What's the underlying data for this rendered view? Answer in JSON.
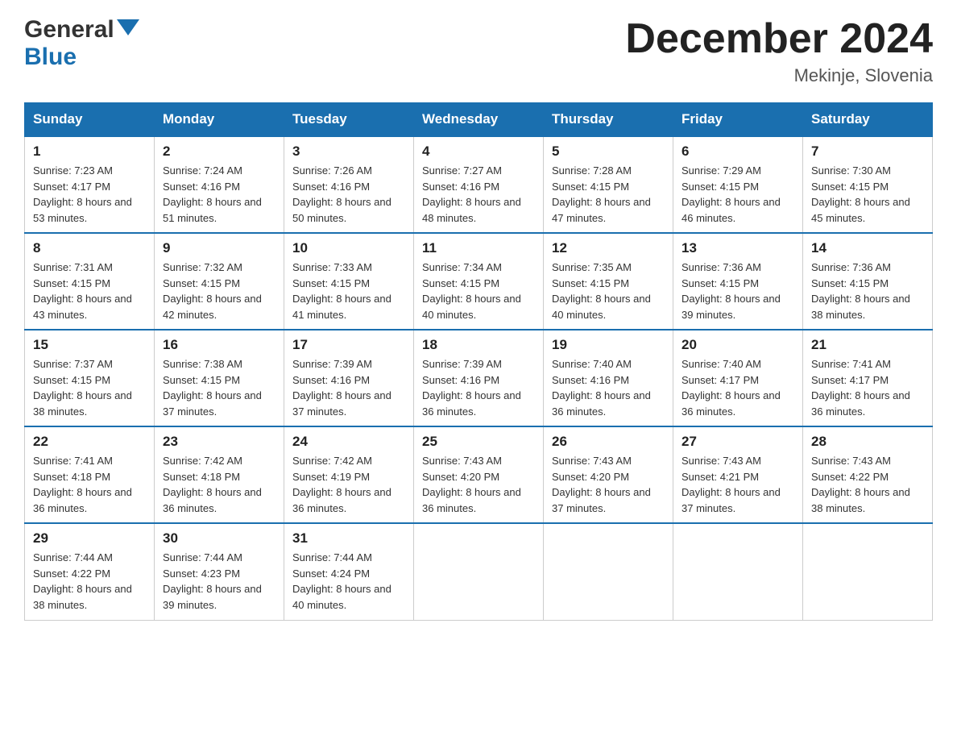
{
  "header": {
    "logo_general": "General",
    "logo_blue": "Blue",
    "month_title": "December 2024",
    "location": "Mekinje, Slovenia"
  },
  "days_of_week": [
    "Sunday",
    "Monday",
    "Tuesday",
    "Wednesday",
    "Thursday",
    "Friday",
    "Saturday"
  ],
  "weeks": [
    [
      {
        "day": "1",
        "sunrise": "7:23 AM",
        "sunset": "4:17 PM",
        "daylight": "8 hours and 53 minutes."
      },
      {
        "day": "2",
        "sunrise": "7:24 AM",
        "sunset": "4:16 PM",
        "daylight": "8 hours and 51 minutes."
      },
      {
        "day": "3",
        "sunrise": "7:26 AM",
        "sunset": "4:16 PM",
        "daylight": "8 hours and 50 minutes."
      },
      {
        "day": "4",
        "sunrise": "7:27 AM",
        "sunset": "4:16 PM",
        "daylight": "8 hours and 48 minutes."
      },
      {
        "day": "5",
        "sunrise": "7:28 AM",
        "sunset": "4:15 PM",
        "daylight": "8 hours and 47 minutes."
      },
      {
        "day": "6",
        "sunrise": "7:29 AM",
        "sunset": "4:15 PM",
        "daylight": "8 hours and 46 minutes."
      },
      {
        "day": "7",
        "sunrise": "7:30 AM",
        "sunset": "4:15 PM",
        "daylight": "8 hours and 45 minutes."
      }
    ],
    [
      {
        "day": "8",
        "sunrise": "7:31 AM",
        "sunset": "4:15 PM",
        "daylight": "8 hours and 43 minutes."
      },
      {
        "day": "9",
        "sunrise": "7:32 AM",
        "sunset": "4:15 PM",
        "daylight": "8 hours and 42 minutes."
      },
      {
        "day": "10",
        "sunrise": "7:33 AM",
        "sunset": "4:15 PM",
        "daylight": "8 hours and 41 minutes."
      },
      {
        "day": "11",
        "sunrise": "7:34 AM",
        "sunset": "4:15 PM",
        "daylight": "8 hours and 40 minutes."
      },
      {
        "day": "12",
        "sunrise": "7:35 AM",
        "sunset": "4:15 PM",
        "daylight": "8 hours and 40 minutes."
      },
      {
        "day": "13",
        "sunrise": "7:36 AM",
        "sunset": "4:15 PM",
        "daylight": "8 hours and 39 minutes."
      },
      {
        "day": "14",
        "sunrise": "7:36 AM",
        "sunset": "4:15 PM",
        "daylight": "8 hours and 38 minutes."
      }
    ],
    [
      {
        "day": "15",
        "sunrise": "7:37 AM",
        "sunset": "4:15 PM",
        "daylight": "8 hours and 38 minutes."
      },
      {
        "day": "16",
        "sunrise": "7:38 AM",
        "sunset": "4:15 PM",
        "daylight": "8 hours and 37 minutes."
      },
      {
        "day": "17",
        "sunrise": "7:39 AM",
        "sunset": "4:16 PM",
        "daylight": "8 hours and 37 minutes."
      },
      {
        "day": "18",
        "sunrise": "7:39 AM",
        "sunset": "4:16 PM",
        "daylight": "8 hours and 36 minutes."
      },
      {
        "day": "19",
        "sunrise": "7:40 AM",
        "sunset": "4:16 PM",
        "daylight": "8 hours and 36 minutes."
      },
      {
        "day": "20",
        "sunrise": "7:40 AM",
        "sunset": "4:17 PM",
        "daylight": "8 hours and 36 minutes."
      },
      {
        "day": "21",
        "sunrise": "7:41 AM",
        "sunset": "4:17 PM",
        "daylight": "8 hours and 36 minutes."
      }
    ],
    [
      {
        "day": "22",
        "sunrise": "7:41 AM",
        "sunset": "4:18 PM",
        "daylight": "8 hours and 36 minutes."
      },
      {
        "day": "23",
        "sunrise": "7:42 AM",
        "sunset": "4:18 PM",
        "daylight": "8 hours and 36 minutes."
      },
      {
        "day": "24",
        "sunrise": "7:42 AM",
        "sunset": "4:19 PM",
        "daylight": "8 hours and 36 minutes."
      },
      {
        "day": "25",
        "sunrise": "7:43 AM",
        "sunset": "4:20 PM",
        "daylight": "8 hours and 36 minutes."
      },
      {
        "day": "26",
        "sunrise": "7:43 AM",
        "sunset": "4:20 PM",
        "daylight": "8 hours and 37 minutes."
      },
      {
        "day": "27",
        "sunrise": "7:43 AM",
        "sunset": "4:21 PM",
        "daylight": "8 hours and 37 minutes."
      },
      {
        "day": "28",
        "sunrise": "7:43 AM",
        "sunset": "4:22 PM",
        "daylight": "8 hours and 38 minutes."
      }
    ],
    [
      {
        "day": "29",
        "sunrise": "7:44 AM",
        "sunset": "4:22 PM",
        "daylight": "8 hours and 38 minutes."
      },
      {
        "day": "30",
        "sunrise": "7:44 AM",
        "sunset": "4:23 PM",
        "daylight": "8 hours and 39 minutes."
      },
      {
        "day": "31",
        "sunrise": "7:44 AM",
        "sunset": "4:24 PM",
        "daylight": "8 hours and 40 minutes."
      },
      null,
      null,
      null,
      null
    ]
  ],
  "labels": {
    "sunrise": "Sunrise:",
    "sunset": "Sunset:",
    "daylight": "Daylight:"
  }
}
